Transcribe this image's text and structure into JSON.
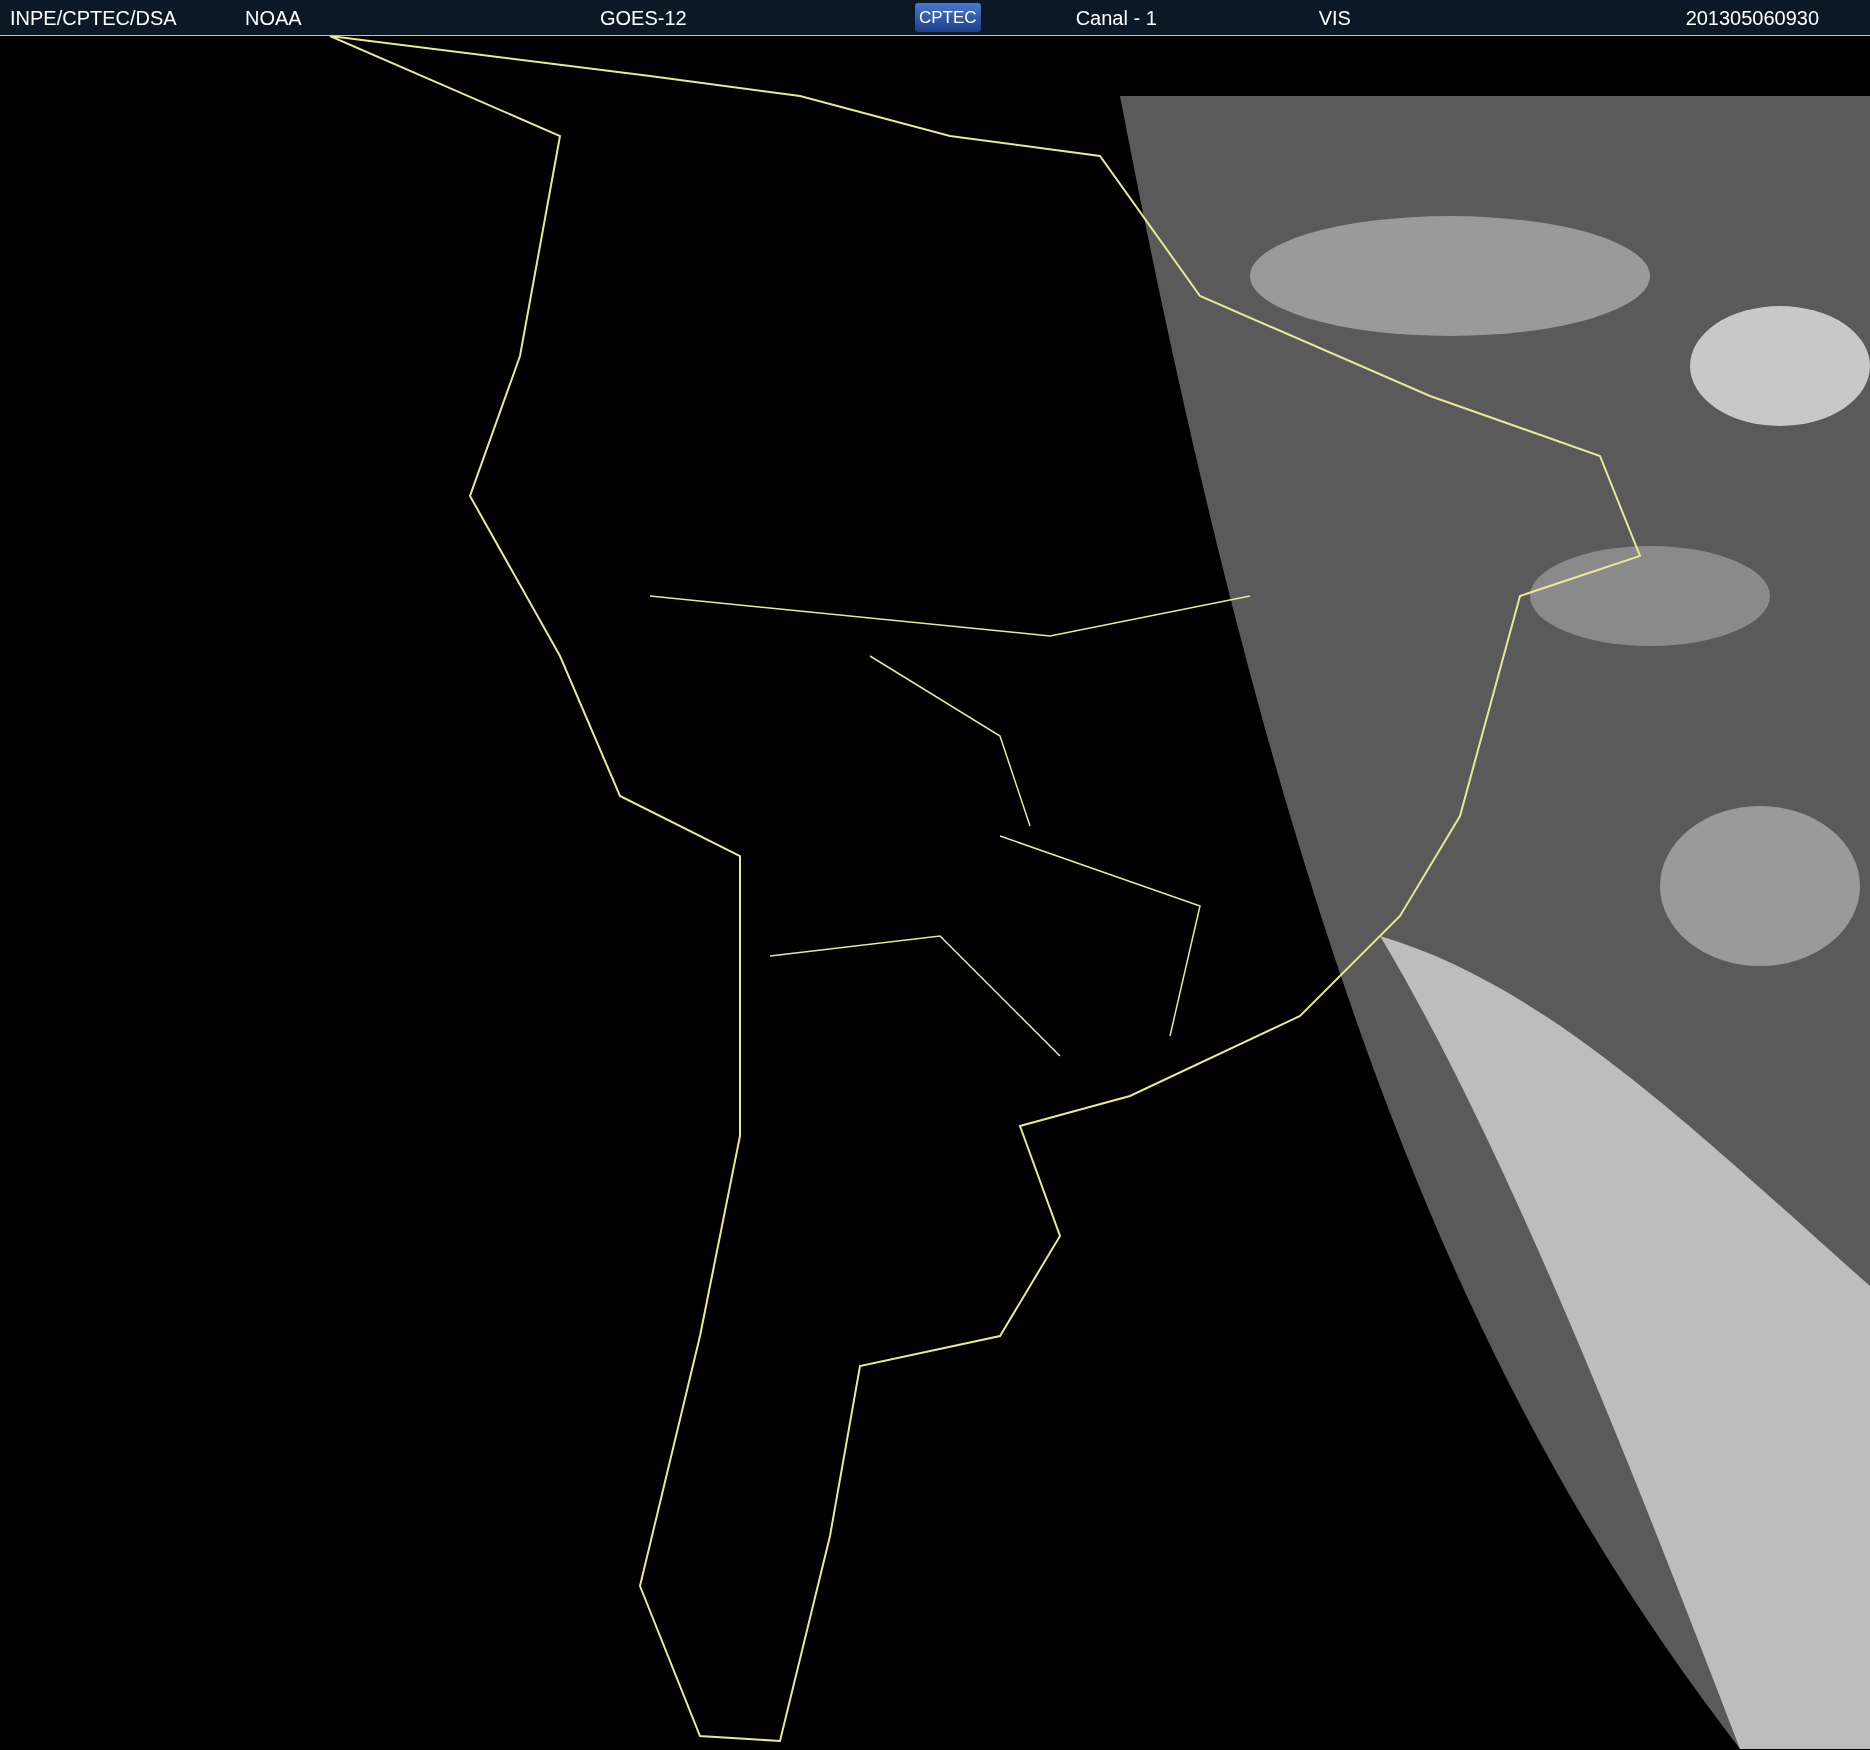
{
  "header": {
    "items": [
      {
        "kind": "text",
        "text": "INPE/CPTEC/DSA"
      },
      {
        "kind": "text",
        "text": "NOAA"
      },
      {
        "kind": "text",
        "text": "GOES-12"
      },
      {
        "kind": "logo",
        "text": "CPTEC"
      },
      {
        "kind": "text",
        "text": "Canal - 1"
      },
      {
        "kind": "text",
        "text": "VIS"
      },
      {
        "kind": "text",
        "text": "201305060930"
      }
    ]
  }
}
